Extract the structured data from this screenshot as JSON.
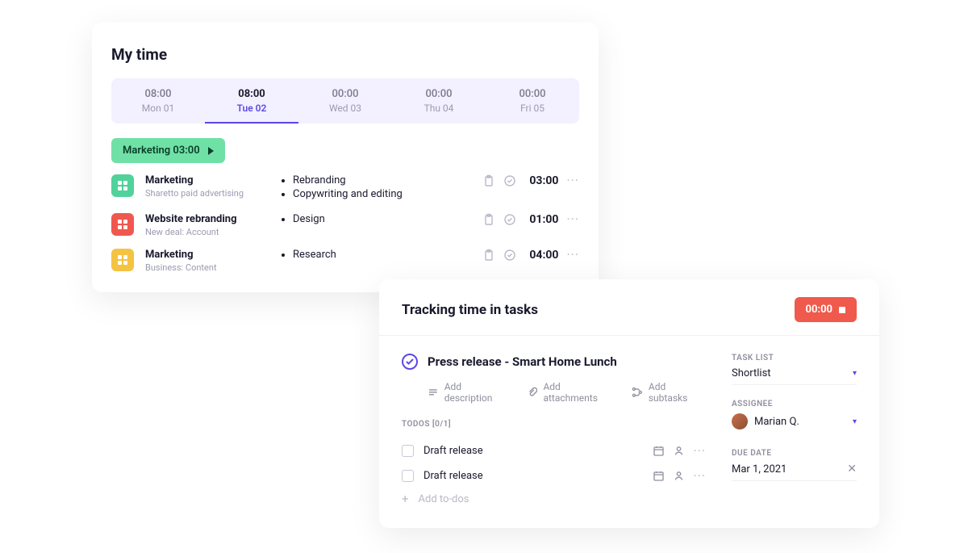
{
  "mytime": {
    "title": "My time",
    "days": [
      {
        "time": "08:00",
        "label": "Mon 01"
      },
      {
        "time": "08:00",
        "label": "Tue 02",
        "active": true
      },
      {
        "time": "00:00",
        "label": "Wed 03"
      },
      {
        "time": "00:00",
        "label": "Thu 04"
      },
      {
        "time": "00:00",
        "label": "Fri 05"
      }
    ],
    "running": {
      "label": "Marketing 03:00"
    },
    "entries": [
      {
        "color": "#51d29a",
        "title": "Marketing",
        "subtitle": "Sharetto paid advertising",
        "tasks": [
          "Rebranding",
          "Copywriting and editing"
        ],
        "duration": "03:00"
      },
      {
        "color": "#f0584f",
        "title": "Website rebranding",
        "subtitle": "New deal: Account",
        "tasks": [
          "Design"
        ],
        "duration": "01:00"
      },
      {
        "color": "#f5c342",
        "title": "Marketing",
        "subtitle": "Business: Content",
        "tasks": [
          "Research"
        ],
        "duration": "04:00"
      }
    ]
  },
  "taskcard": {
    "title": "Tracking time in tasks",
    "timer": "00:00",
    "task_title": "Press release - Smart Home Lunch",
    "actions": {
      "add_description": "Add description",
      "add_attachments": "Add attachments",
      "add_subtasks": "Add subtasks"
    },
    "todos_header": "TODOS [0/1]",
    "todos": [
      {
        "label": "Draft release"
      },
      {
        "label": "Draft release"
      }
    ],
    "add_todos": "Add to-dos",
    "side": {
      "tasklist_label": "TASK LIST",
      "tasklist_value": "Shortlist",
      "assignee_label": "ASSIGNEE",
      "assignee_value": "Marian Q.",
      "duedate_label": "DUE DATE",
      "duedate_value": "Mar 1, 2021"
    }
  }
}
